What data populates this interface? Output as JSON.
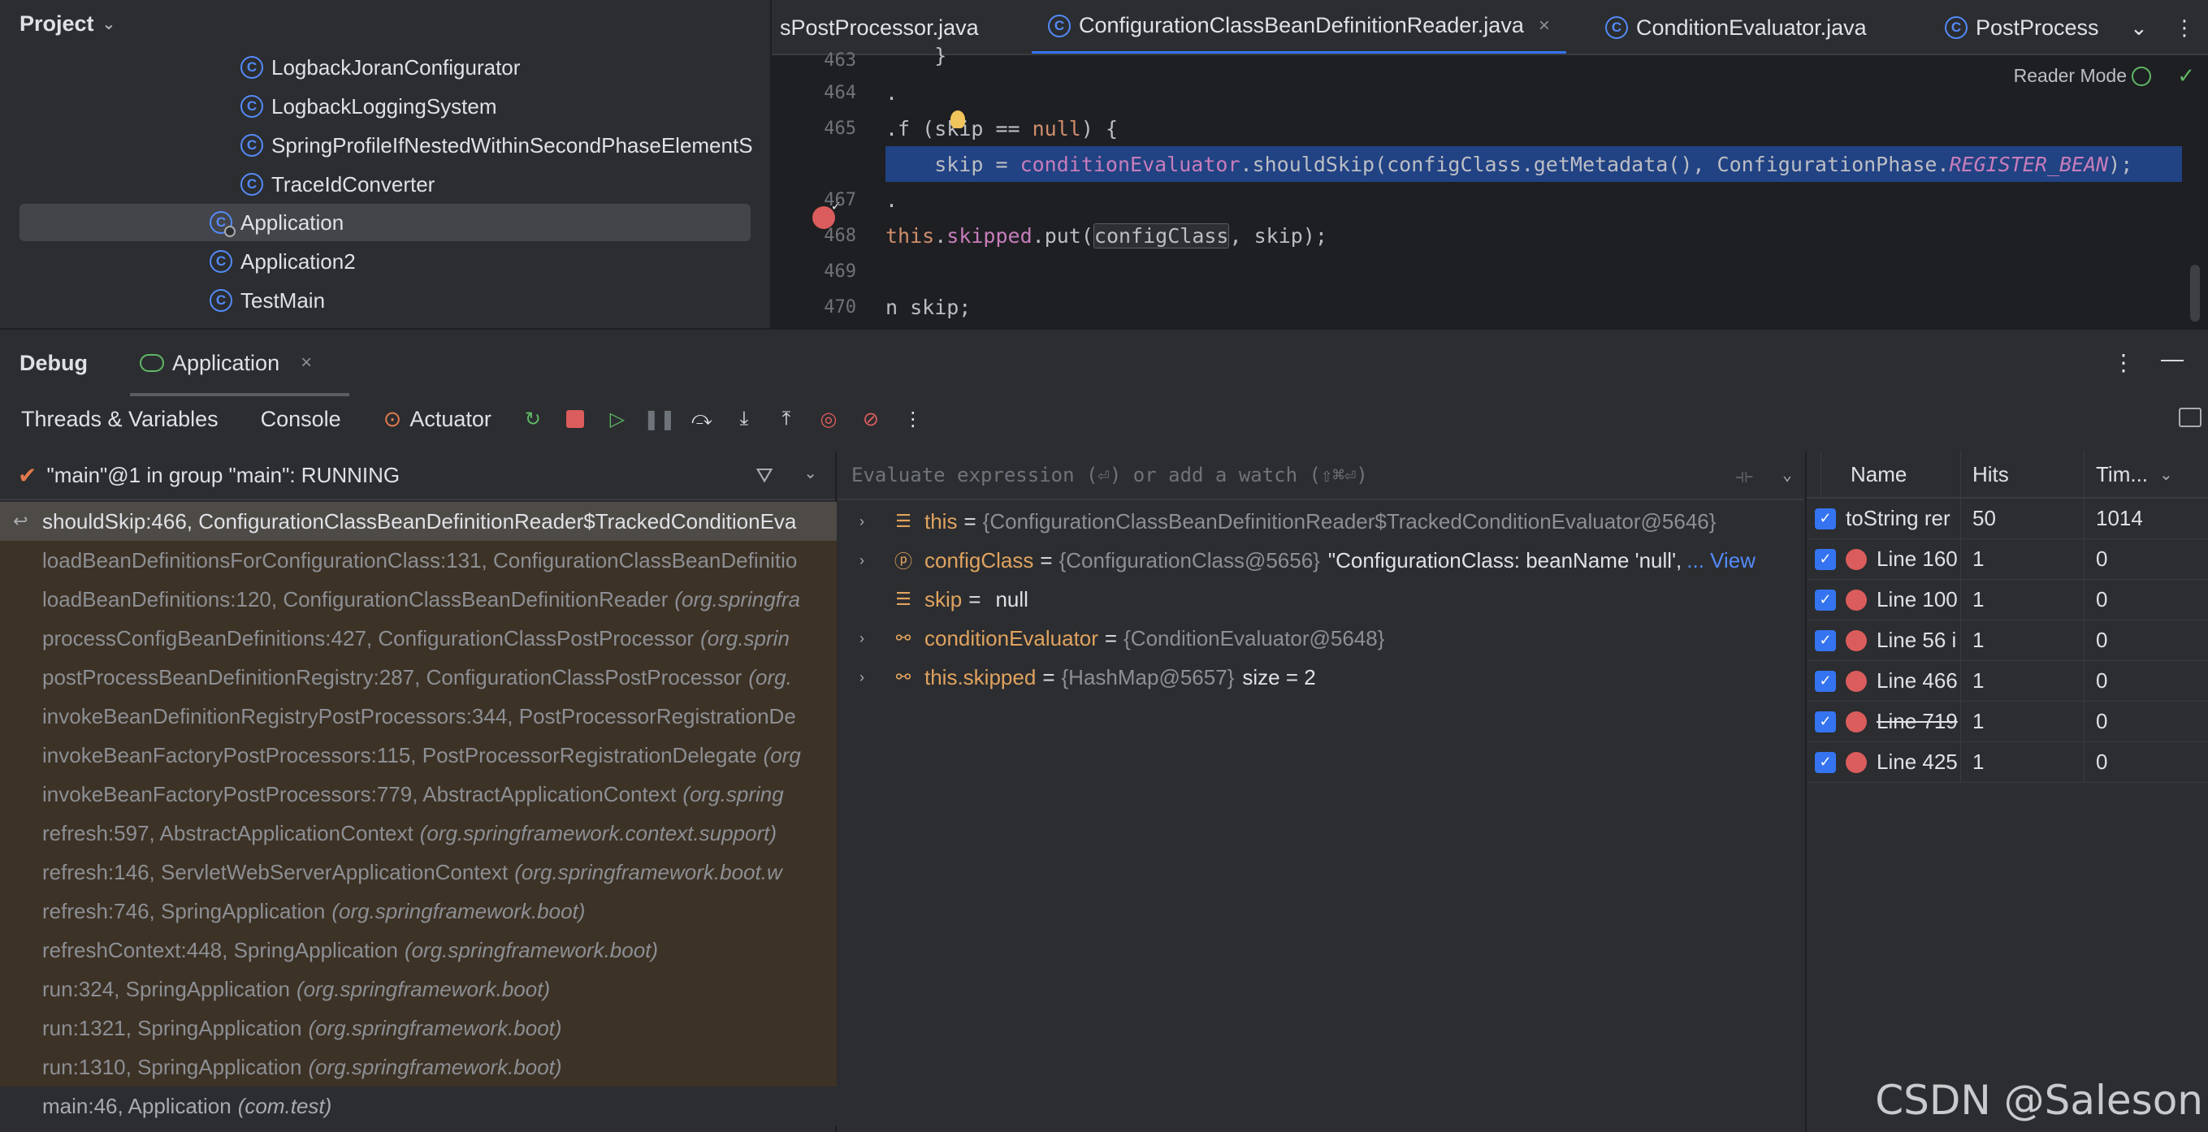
{
  "project": {
    "title": "Project",
    "tree": [
      {
        "label": "LogbackJoranConfigurator",
        "icon": "class-icon"
      },
      {
        "label": "LogbackLoggingSystem",
        "icon": "class-icon"
      },
      {
        "label": "SpringProfileIfNestedWithinSecondPhaseElementS",
        "icon": "class-icon"
      },
      {
        "label": "TraceIdConverter",
        "icon": "class-icon"
      },
      {
        "label": "Application",
        "icon": "runnable-class-icon",
        "selected": true
      },
      {
        "label": "Application2",
        "icon": "class-icon"
      },
      {
        "label": "TestMain",
        "icon": "class-icon"
      }
    ]
  },
  "editor": {
    "tabs": [
      {
        "label": "sPostProcessor.java"
      },
      {
        "label": "ConfigurationClassBeanDefinitionReader.java",
        "active": true,
        "close": "×"
      },
      {
        "label": "ConditionEvaluator.java"
      },
      {
        "label": "PostProcess"
      }
    ],
    "reader_mode": "Reader Mode",
    "line_numbers": [
      "463",
      "464",
      "465",
      "466",
      "467",
      "468",
      "469",
      "470"
    ],
    "lines": {
      "l463": "    }",
      "l464": ".",
      "l465_a": ".f (sk",
      "l465_b": "ip == ",
      "l465_null": "null",
      "l465_c": ") {",
      "l466_a": "    skip = ",
      "l466_field": "conditionEvaluator",
      "l466_b": ".shouldSkip(configClass.getMetadata(), ConfigurationPhase.",
      "l466_const": "REGISTER_BEAN",
      "l466_c": ");",
      "l467": ".",
      "l468_a": "this",
      "l468_b": ".",
      "l468_field": "skipped",
      "l468_c": ".put(",
      "l468_boxed": "configClass",
      "l468_d": ", skip);",
      "l470": "n skip;"
    }
  },
  "debug": {
    "title": "Debug",
    "session": "Application",
    "session_close": "×",
    "tabs": [
      "Threads & Variables",
      "Console"
    ],
    "actuator": "Actuator",
    "thread": "\"main\"@1 in group \"main\": RUNNING",
    "frames": [
      {
        "method": "shouldSkip:466, ConfigurationClassBeanDefinitionReader$TrackedConditionEva",
        "pkg": "",
        "style": "current"
      },
      {
        "method": "loadBeanDefinitionsForConfigurationClass:131, ConfigurationClassBeanDefinitio",
        "pkg": "",
        "style": "lib"
      },
      {
        "method": "loadBeanDefinitions:120, ConfigurationClassBeanDefinitionReader",
        "pkg": "(org.springfra",
        "style": "lib"
      },
      {
        "method": "processConfigBeanDefinitions:427, ConfigurationClassPostProcessor",
        "pkg": "(org.sprin",
        "style": "lib"
      },
      {
        "method": "postProcessBeanDefinitionRegistry:287, ConfigurationClassPostProcessor",
        "pkg": "(org.",
        "style": "lib"
      },
      {
        "method": "invokeBeanDefinitionRegistryPostProcessors:344, PostProcessorRegistrationDe",
        "pkg": "",
        "style": "lib"
      },
      {
        "method": "invokeBeanFactoryPostProcessors:115, PostProcessorRegistrationDelegate",
        "pkg": "(org",
        "style": "lib"
      },
      {
        "method": "invokeBeanFactoryPostProcessors:779, AbstractApplicationContext",
        "pkg": "(org.spring",
        "style": "lib"
      },
      {
        "method": "refresh:597, AbstractApplicationContext",
        "pkg": "(org.springframework.context.support)",
        "style": "lib"
      },
      {
        "method": "refresh:146, ServletWebServerApplicationContext",
        "pkg": "(org.springframework.boot.w",
        "style": "lib"
      },
      {
        "method": "refresh:746, SpringApplication",
        "pkg": "(org.springframework.boot)",
        "style": "lib"
      },
      {
        "method": "refreshContext:448, SpringApplication",
        "pkg": "(org.springframework.boot)",
        "style": "lib"
      },
      {
        "method": "run:324, SpringApplication",
        "pkg": "(org.springframework.boot)",
        "style": "lib"
      },
      {
        "method": "run:1321, SpringApplication",
        "pkg": "(org.springframework.boot)",
        "style": "lib"
      },
      {
        "method": "run:1310, SpringApplication",
        "pkg": "(org.springframework.boot)",
        "style": "lib"
      },
      {
        "method": "main:46, Application",
        "pkg": "(com.test)",
        "style": "normal"
      }
    ],
    "eval_placeholder": "Evaluate expression (⏎) or add a watch (⇧⌘⏎)",
    "variables": [
      {
        "expand": "›",
        "icon": "field-icon",
        "name": "this",
        "eq": "=",
        "type": "{ConfigurationClassBeanDefinitionReader$TrackedConditionEvaluator@5646}",
        "value": "",
        "link": ""
      },
      {
        "expand": "›",
        "icon": "parameter-icon",
        "name": "configClass",
        "eq": "=",
        "type": "{ConfigurationClass@5656}",
        "value": "\"ConfigurationClass: beanName 'null',",
        "link": "... View"
      },
      {
        "expand": "",
        "icon": "field-icon",
        "name": "skip",
        "eq": "=",
        "type": "",
        "value": "null",
        "link": ""
      },
      {
        "expand": "›",
        "icon": "watch-icon",
        "name": "conditionEvaluator",
        "eq": "=",
        "type": "{ConditionEvaluator@5648}",
        "value": "",
        "link": ""
      },
      {
        "expand": "›",
        "icon": "watch-icon",
        "name": "this.skipped",
        "eq": "=",
        "type": "{HashMap@5657}",
        "value": "size = 2",
        "link": ""
      }
    ],
    "breakpoints": {
      "columns": [
        "Name",
        "Hits",
        "Tim..."
      ],
      "rows": [
        {
          "name": "toString rer",
          "hits": "50",
          "time": "1014",
          "dot": false,
          "strike": false
        },
        {
          "name": "Line 160",
          "hits": "1",
          "time": "0",
          "dot": true,
          "strike": false
        },
        {
          "name": "Line 100",
          "hits": "1",
          "time": "0",
          "dot": true,
          "strike": false
        },
        {
          "name": "Line 56 i",
          "hits": "1",
          "time": "0",
          "dot": true,
          "strike": false
        },
        {
          "name": "Line 466",
          "hits": "1",
          "time": "0",
          "dot": true,
          "strike": false
        },
        {
          "name": "Line 719",
          "hits": "1",
          "time": "0",
          "dot": true,
          "strike": true
        },
        {
          "name": "Line 425",
          "hits": "1",
          "time": "0",
          "dot": true,
          "strike": false
        }
      ]
    }
  },
  "watermark": "CSDN @Saleson"
}
